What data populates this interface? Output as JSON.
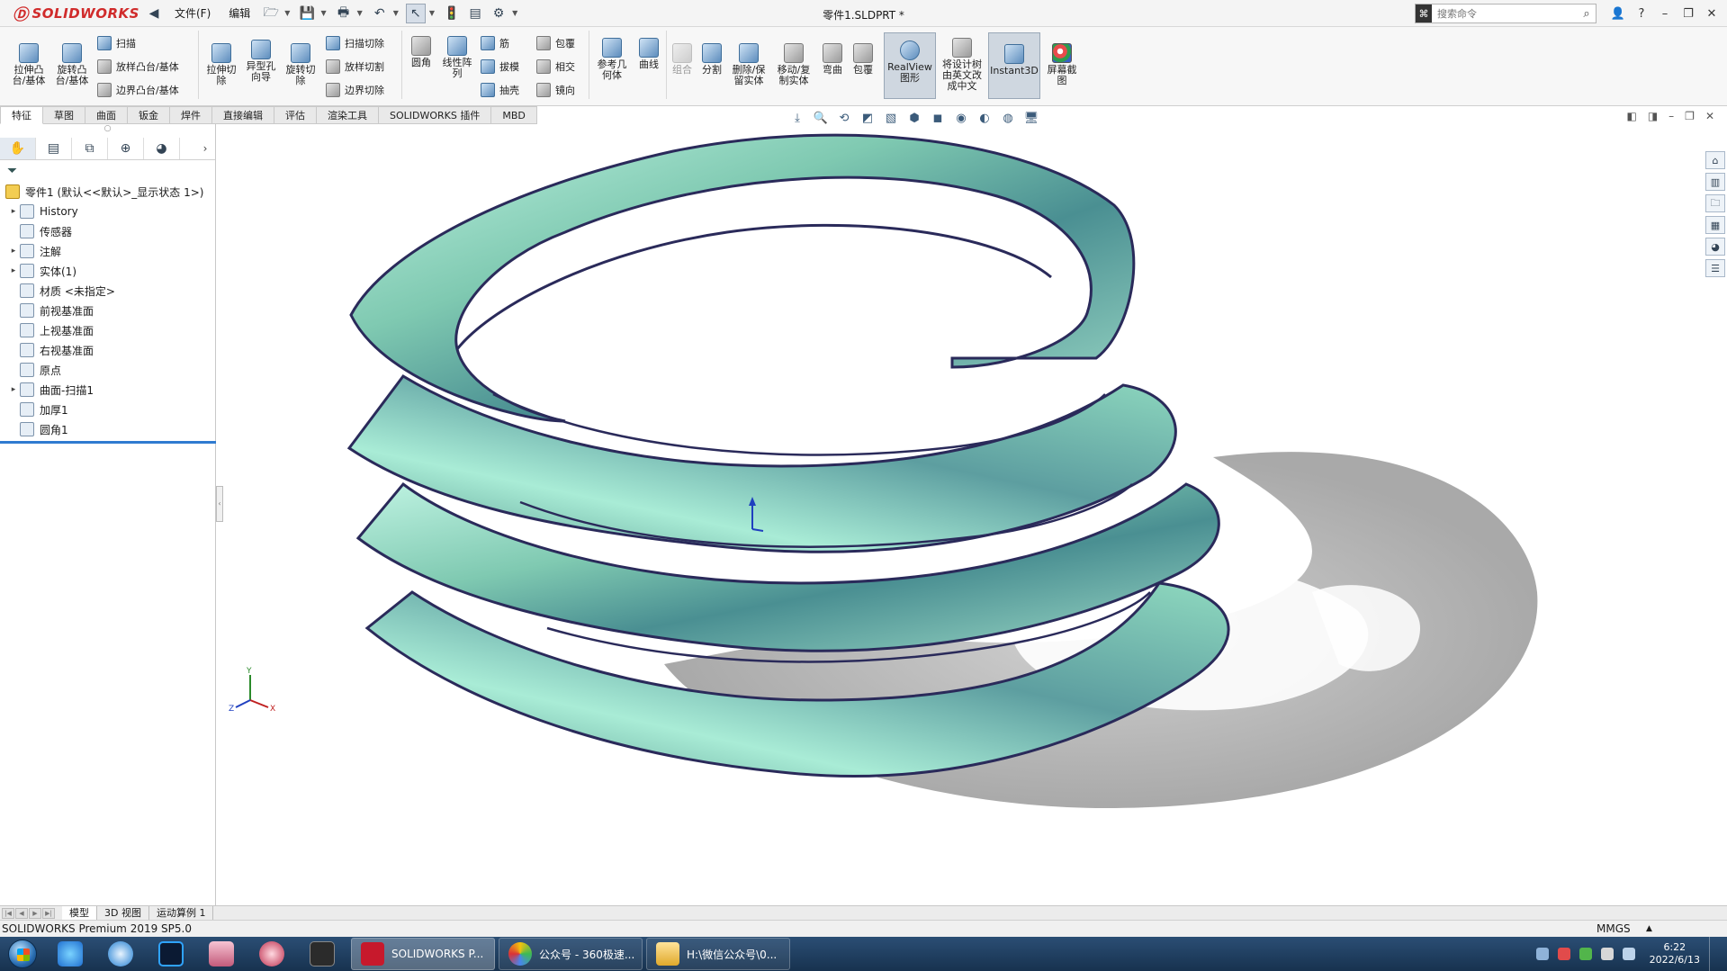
{
  "titlebar": {
    "logo": "SOLIDWORKS",
    "menu_file": "文件(F)",
    "menu_edit": "编辑",
    "doc_title": "零件1.SLDPRT *",
    "search_placeholder": "搜索命令",
    "help": "?"
  },
  "ribbon": {
    "extrude_boss": "拉伸凸\n台/基体",
    "revolve_boss": "旋转凸\n台/基体",
    "sweep": "扫描",
    "loft_boss": "放样凸台/基体",
    "boundary_boss": "边界凸台/基体",
    "extrude_cut": "拉伸切\n除",
    "hole_wizard": "异型孔\n向导",
    "revolve_cut": "旋转切\n除",
    "swept_cut": "扫描切除",
    "lofted_cut": "放样切割",
    "boundary_cut": "边界切除",
    "fillet": "圆角",
    "linear_pattern": "线性阵\n列",
    "rib": "筋",
    "draft": "拔模",
    "shell": "抽壳",
    "wrap": "包覆",
    "intersect": "相交",
    "mirror": "镜向",
    "reference_geometry": "参考几\n何体",
    "curves": "曲线",
    "combine": "组合",
    "split": "分割",
    "delete_body": "删除/保\n留实体",
    "move_copy": "移动/复\n制实体",
    "flex": "弯曲",
    "wrap2": "包覆",
    "realview": "RealView\n图形",
    "translate_tree": "将设计树\n由英文改\n成中文",
    "instant3d": "Instant3D",
    "screen_capture": "屏幕截\n图"
  },
  "tabs": [
    "特征",
    "草图",
    "曲面",
    "钣金",
    "焊件",
    "直接编辑",
    "评估",
    "渲染工具",
    "SOLIDWORKS 插件",
    "MBD"
  ],
  "feature_tree": {
    "root": "零件1  (默认<<默认>_显示状态 1>)",
    "items": [
      "History",
      "传感器",
      "注解",
      "实体(1)",
      "材质 <未指定>",
      "前视基准面",
      "上视基准面",
      "右视基准面",
      "原点",
      "曲面-扫描1",
      "加厚1",
      "圆角1"
    ]
  },
  "bottom_tabs": [
    "模型",
    "3D 视图",
    "运动算例 1"
  ],
  "status": {
    "product": "SOLIDWORKS Premium 2019 SP5.0",
    "units": "MMGS"
  },
  "taskbar": {
    "items": [
      "SOLIDWORKS P...",
      "公众号 - 360极速...",
      "H:\\微信公众号\\0..."
    ],
    "time": "6:22",
    "date": "2022/6/13"
  },
  "colors": {
    "part_light": "#bff3e2",
    "part_mid": "#7fc9b1",
    "part_dark": "#3f7f86",
    "edge": "#2a2a5a",
    "shadow": "#9a9a9a"
  }
}
